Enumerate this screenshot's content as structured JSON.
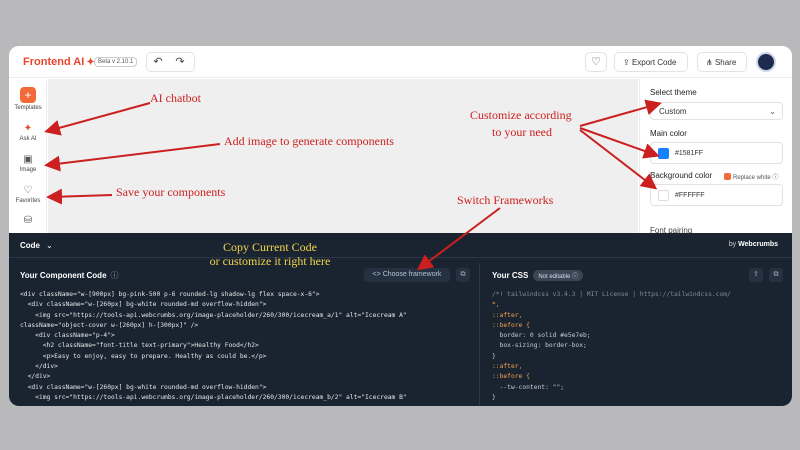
{
  "header": {
    "logo": "Frontend AI",
    "version": "Beta v 2.10.1",
    "export_label": "Export Code",
    "share_label": "Share"
  },
  "sidebar": {
    "items": [
      {
        "label": "Templates",
        "icon": "plus-icon"
      },
      {
        "label": "Ask AI",
        "icon": "sparkle-icon"
      },
      {
        "label": "Image",
        "icon": "image-icon"
      },
      {
        "label": "Favorites",
        "icon": "heart-icon"
      },
      {
        "label": "",
        "icon": "bucket-icon"
      }
    ]
  },
  "right_panel": {
    "select_theme_label": "Select theme",
    "theme_value": "Custom",
    "main_color_label": "Main color",
    "main_color_value": "#1581FF",
    "background_color_label": "Background color",
    "replace_white_label": "Replace white",
    "background_color_value": "#FFFFFF",
    "font_label": "Font pairing"
  },
  "colors": {
    "main": "#1581FF",
    "background": "#FFFFFF",
    "accent": "#F26A3A",
    "annotation": "#CC1F1F"
  },
  "code_panel": {
    "header_label": "Code",
    "by_prefix": "by",
    "by_brand": "Webcrumbs",
    "component_title": "Your Component Code",
    "choose_framework": "Choose framework",
    "css_title": "Your CSS",
    "not_editable": "Not editable",
    "code_lines": [
      "<div className=\"w-[900px] bg-pink-500 p-6 rounded-lg shadow-lg flex space-x-6\">",
      "  <div className=\"w-[260px] bg-white rounded-md overflow-hidden\">",
      "    <img src=\"https://tools-api.webcrumbs.org/image-placeholder/260/300/icecream_a/1\" alt=\"Icecream A\"",
      "className=\"object-cover w-[260px] h-[300px]\" />",
      "    <div className=\"p-4\">",
      "      <h2 className=\"font-title text-primary\">Healthy Food</h2>",
      "      <p>Easy to enjoy, easy to prepare. Healthy as could be.</p>",
      "    </div>",
      "  </div>",
      "  <div className=\"w-[260px] bg-white rounded-md overflow-hidden\">",
      "    <img src=\"https://tools-api.webcrumbs.org/image-placeholder/260/300/icecream_b/2\" alt=\"Icecream B\""
    ],
    "css_lines": [
      "/*! tailwindcss v3.4.3 | MIT License | https://tailwindcss.com/",
      "*,",
      "::after,",
      "::before {",
      "  border: 0 solid #e5e7eb;",
      "  box-sizing: border-box;",
      "}",
      "::after,",
      "::before {",
      "  --tw-content: \"\";",
      "}"
    ]
  },
  "annotations": {
    "ai_chatbot": "AI chatbot",
    "add_image": "Add image to generate components",
    "save_components": "Save your components",
    "customize_1": "Customize according",
    "customize_2": "to your need",
    "switch_frameworks": "Switch Frameworks",
    "copy_1": "Copy Current Code",
    "copy_2": "or customize it right here"
  }
}
